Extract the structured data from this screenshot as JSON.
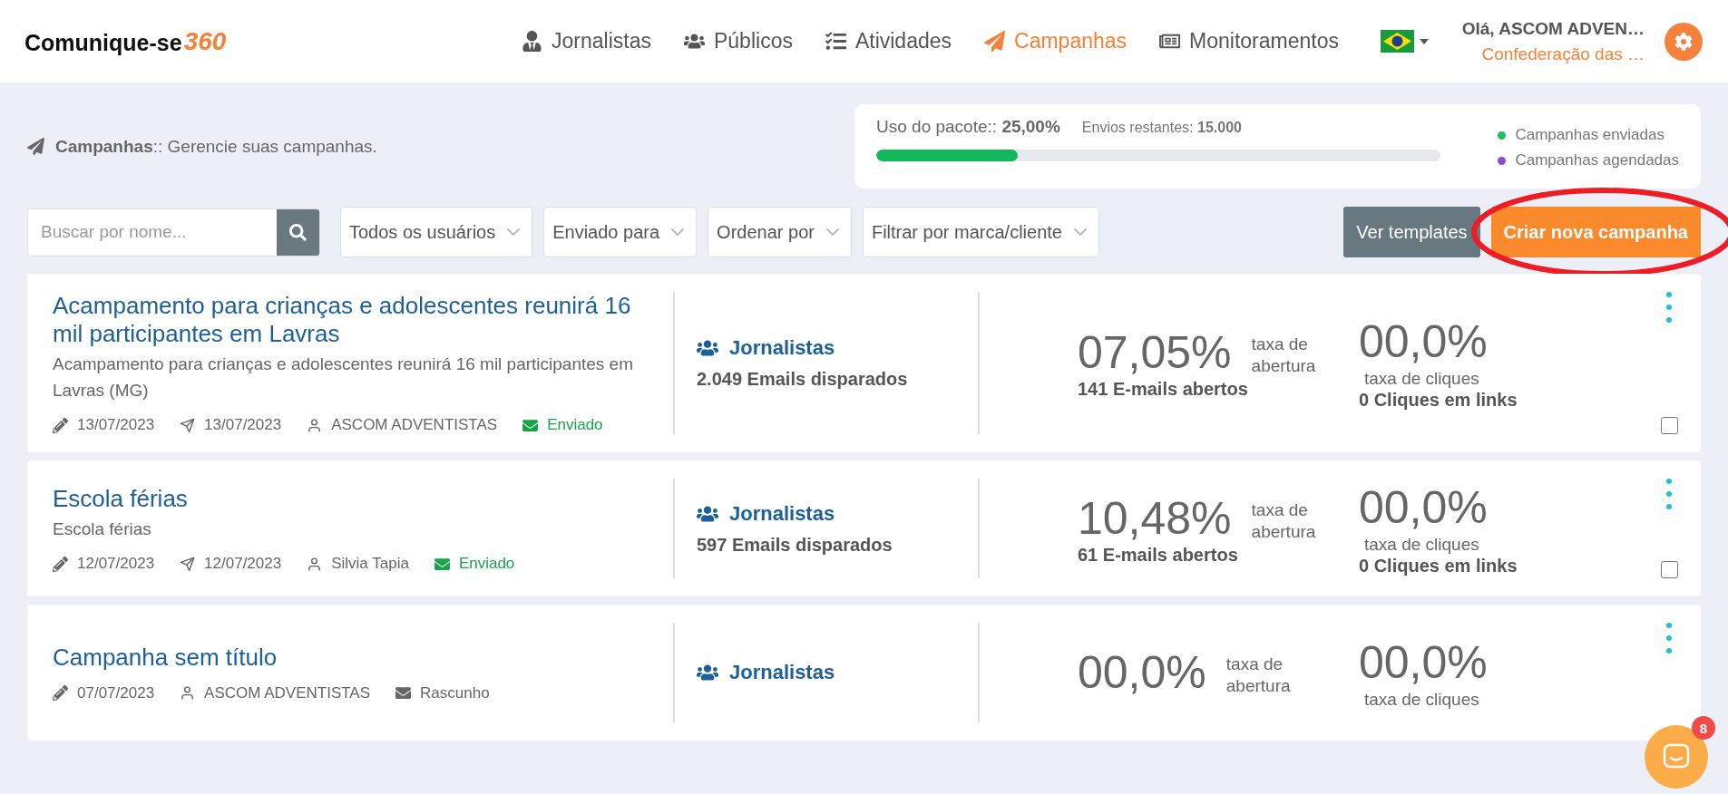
{
  "header": {
    "logo": {
      "text": "Comunique-se",
      "accent": "360"
    },
    "nav": [
      {
        "label": "Jornalistas",
        "selected": false
      },
      {
        "label": "Públicos",
        "selected": false
      },
      {
        "label": "Atividades",
        "selected": false
      },
      {
        "label": "Campanhas",
        "selected": true
      },
      {
        "label": "Monitoramentos",
        "selected": false
      }
    ],
    "user": {
      "greeting": "Olá, ASCOM ADVEN…",
      "org": "Confederação das …"
    }
  },
  "page_title": "**Campanhas**:: Gerencie suas campanhas.",
  "usage": {
    "label": "Uso do pacote:: **25,00%**",
    "remaining": "Envios restantes: **15.000**",
    "level": 0.25,
    "legend": [
      {
        "label": "Campanhas enviadas",
        "color": "#1cc15b"
      },
      {
        "label": "Campanhas agendadas",
        "color": "#8a4fcf"
      }
    ]
  },
  "toolbar": {
    "search": {
      "placeholder": "Buscar por nome..."
    },
    "filters": [
      "Todos os usuários",
      "Enviado para",
      "Ordenar por",
      "Filtrar por marca/cliente"
    ],
    "templates_button": "Ver templates",
    "create_button": "Criar nova campanha"
  },
  "campaigns": [
    {
      "title": "Acampamento para crianças e adolescentes reunirá 16 mil participantes em Lavras",
      "subtitle": "Acampamento para crianças e adolescentes reunirá 16 mil participantes em Lavras (MG)",
      "meta": [
        {
          "kind": "edited",
          "text": "13/07/2023"
        },
        {
          "kind": "sent",
          "text": "13/07/2023"
        },
        {
          "kind": "author",
          "text": "ASCOM ADVENTISTAS"
        }
      ],
      "status": {
        "kind": "sent",
        "label": "Enviado"
      },
      "audience": "Jornalistas",
      "emails_sent": "2.049 Emails disparados",
      "open_rate": "07,05%",
      "open_label": "taxa de abertura",
      "opens": "141 E-mails abertos",
      "click_rate": "00,0%",
      "click_label": "taxa de cliques",
      "clicks": "0 Cliques em links",
      "checked": false
    },
    {
      "title": "Escola férias",
      "subtitle": "Escola férias",
      "meta": [
        {
          "kind": "edited",
          "text": "12/07/2023"
        },
        {
          "kind": "sent",
          "text": "12/07/2023"
        },
        {
          "kind": "author",
          "text": "Silvia Tapia"
        }
      ],
      "status": {
        "kind": "sent",
        "label": "Enviado"
      },
      "audience": "Jornalistas",
      "emails_sent": "597 Emails disparados",
      "open_rate": "10,48%",
      "open_label": "taxa de abertura",
      "opens": "61 E-mails abertos",
      "click_rate": "00,0%",
      "click_label": "taxa de cliques",
      "clicks": "0 Cliques em links",
      "checked": false
    },
    {
      "title": "Campanha sem título",
      "meta": [
        {
          "kind": "edited",
          "text": "07/07/2023"
        },
        {
          "kind": "author",
          "text": "ASCOM ADVENTISTAS"
        }
      ],
      "status": {
        "kind": "draft",
        "label": "Rascunho"
      },
      "audience": "Jornalistas",
      "open_rate": "00,0%",
      "open_label": "taxa de abertura",
      "click_rate": "00,0%",
      "click_label": "taxa de cliques"
    }
  ],
  "chat": {
    "badge": "8"
  }
}
